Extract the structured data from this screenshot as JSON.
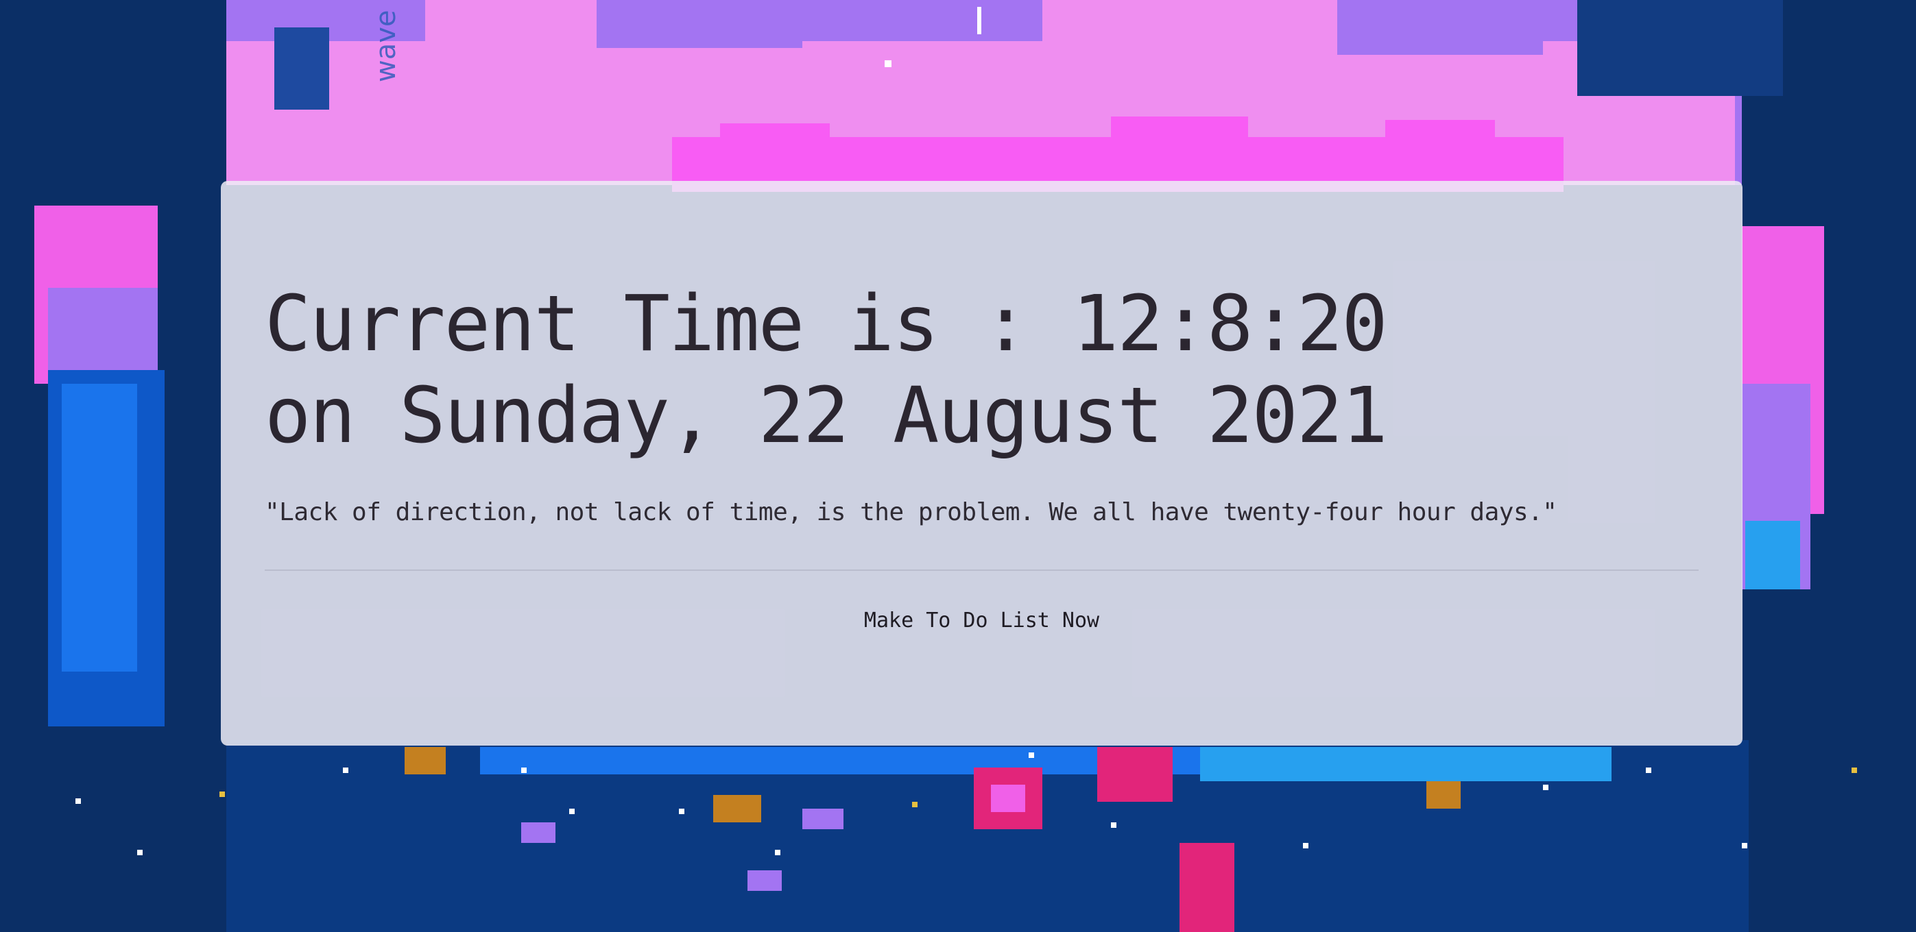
{
  "clock": {
    "time_line": "Current Time is : 12:8:20",
    "date_line": "on Sunday, 22 August 2021"
  },
  "quote": {
    "text": "\"Lack of direction, not lack of time, is the problem. We all have twenty-four hour days.\""
  },
  "actions": {
    "todo_label": "Make To Do List Now"
  },
  "background": {
    "watermark_text": "wave",
    "colors": {
      "sky_pink": "#ef8ef0",
      "cloud_magenta": "#f85cf4",
      "sky_violet": "#a374f2",
      "foliage_dark": "#0b2f66",
      "foliage_blue": "#0e58c8",
      "flower_red": "#e2257a"
    }
  }
}
